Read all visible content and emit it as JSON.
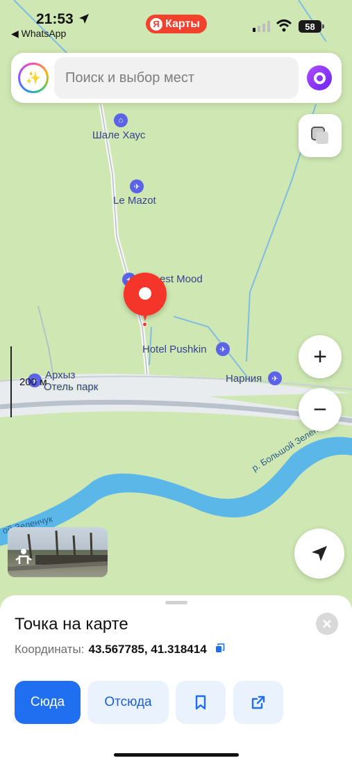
{
  "status_bar": {
    "time": "21:53",
    "back_app": "◀ WhatsApp",
    "brand": "Карты",
    "brand_logo": "Я",
    "battery": "58"
  },
  "search": {
    "placeholder": "Поиск и выбор мест"
  },
  "map": {
    "pois": [
      {
        "label": "Шале Хаус",
        "icon": "hotel-icon"
      },
      {
        "label": "Le Mazot",
        "icon": "plane-icon"
      },
      {
        "label": "est Mood",
        "icon": "star-icon"
      },
      {
        "label": "Hotel Pushkin",
        "icon": "plane-icon"
      },
      {
        "label": "Нарния",
        "icon": "plane-icon"
      },
      {
        "label": "Архыз",
        "icon": "plane-icon"
      },
      {
        "label": "Отель парк"
      }
    ],
    "river_labels": [
      "р. Большой Зеленчук",
      "ой Зеленчук"
    ],
    "scale": "200 м"
  },
  "controls": {
    "zoom_in": "+",
    "zoom_out": "−"
  },
  "sheet": {
    "title": "Точка на карте",
    "coords_label": "Координаты:",
    "coords_value": "43.567785, 41.318414",
    "actions": {
      "here": "Сюда",
      "from_here": "Отсюда"
    }
  },
  "colors": {
    "accent": "#1f6ff0",
    "pin": "#f5352a",
    "brand": "#f2412c",
    "map_bg": "#cfe8b3",
    "river": "#5bb7e8"
  }
}
